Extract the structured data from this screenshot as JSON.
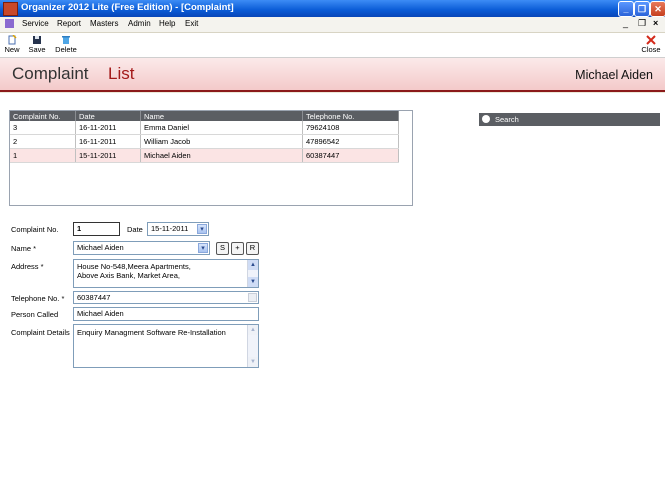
{
  "window": {
    "title": "Organizer 2012 Lite (Free Edition)  - [Complaint]"
  },
  "menu": [
    "Service",
    "Report",
    "Masters",
    "Admin",
    "Help",
    "Exit"
  ],
  "toolbar": {
    "new": "New",
    "save": "Save",
    "delete": "Delete",
    "close": "Close"
  },
  "header": {
    "title_part1": "Complaint",
    "title_part2": "List",
    "user": "Michael Aiden"
  },
  "grid": {
    "columns": [
      "Complaint No.",
      "Date",
      "Name",
      "Telephone No."
    ],
    "rows": [
      [
        "3",
        "16-11-2011",
        "Emma Daniel",
        "79624108"
      ],
      [
        "2",
        "16-11-2011",
        "William Jacob",
        "47896542"
      ],
      [
        "1",
        "15-11-2011",
        "Michael Aiden",
        "60387447"
      ]
    ]
  },
  "form": {
    "complaint_no_label": "Complaint No.",
    "complaint_no": "1",
    "date_label": "Date",
    "date": "15-11-2011",
    "name_label": "Name *",
    "name": "Michael Aiden",
    "btn_s": "S",
    "btn_plus": "+",
    "btn_r": "R",
    "address_label": "Address *",
    "address_line1": "House No-548,Meera Apartments,",
    "address_line2": "Above Axis Bank, Market Area,",
    "telephone_label": "Telephone No. *",
    "telephone": "60387447",
    "person_called_label": "Person Called",
    "person_called": "Michael Aiden",
    "details_label": "Complaint Details",
    "details": "Enquiry Managment Software Re-Installation"
  },
  "search": {
    "label": "Search"
  }
}
